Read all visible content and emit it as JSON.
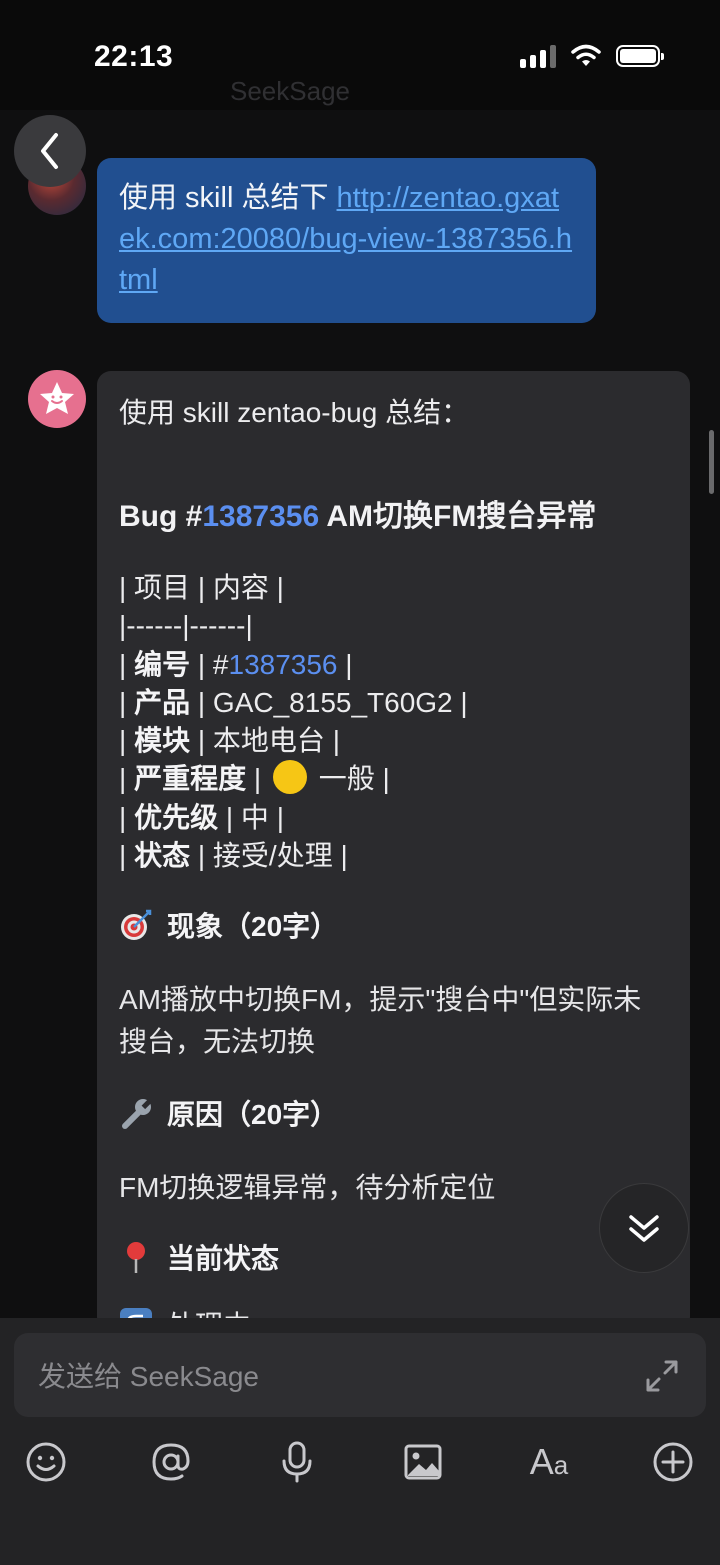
{
  "status_bar": {
    "time": "22:13",
    "battery_level": 1.0,
    "signal_bars": 3
  },
  "header": {
    "title": "SeekSage"
  },
  "messages": {
    "user": {
      "prefix": "使用 skill 总结下 ",
      "link": "http://zentao.gxatek.com:20080/bug-view-1387356.html"
    },
    "bot": {
      "intro": "使用 skill zentao-bug 总结：",
      "title_prefix": "Bug #",
      "title_number": "1387356",
      "title_suffix": " AM切换FM搜台异常",
      "table_header": "| 项目 | 内容 |",
      "table_separator": "|------|------|",
      "rows": [
        {
          "label": "编号",
          "value_prefix": "#",
          "value": "1387356"
        },
        {
          "label": "产品",
          "value": "GAC_8155_T60G2"
        },
        {
          "label": "模块",
          "value": "本地电台"
        },
        {
          "label": "严重程度",
          "value": "一般",
          "indicator_color": "#f6c615"
        },
        {
          "label": "优先级",
          "value": "中"
        },
        {
          "label": "状态",
          "value": "接受/处理"
        }
      ],
      "phenomenon_title": "现象（20字）",
      "phenomenon_icon": "dart-target-icon",
      "phenomenon_text": "AM播放中切换FM，提示\"搜台中\"但实际未搜台，无法切换",
      "cause_title": "原因（20字）",
      "cause_icon": "wrench-icon",
      "cause_text": "FM切换逻辑异常，待分析定位",
      "status_title": "当前状态",
      "status_icon": "pushpin-icon",
      "status_text": "处理中",
      "status_text_icon": "repeat-icon"
    }
  },
  "composer": {
    "placeholder": "发送给 SeekSage",
    "tools": [
      "emoji-icon",
      "at-icon",
      "microphone-icon",
      "image-icon",
      "text-format-icon",
      "plus-circle-icon"
    ]
  },
  "colors": {
    "user_bubble": "#214f90",
    "bot_bubble": "#2b2b2e",
    "link": "#5fa8f5",
    "accent_number": "#5b8ff0"
  }
}
